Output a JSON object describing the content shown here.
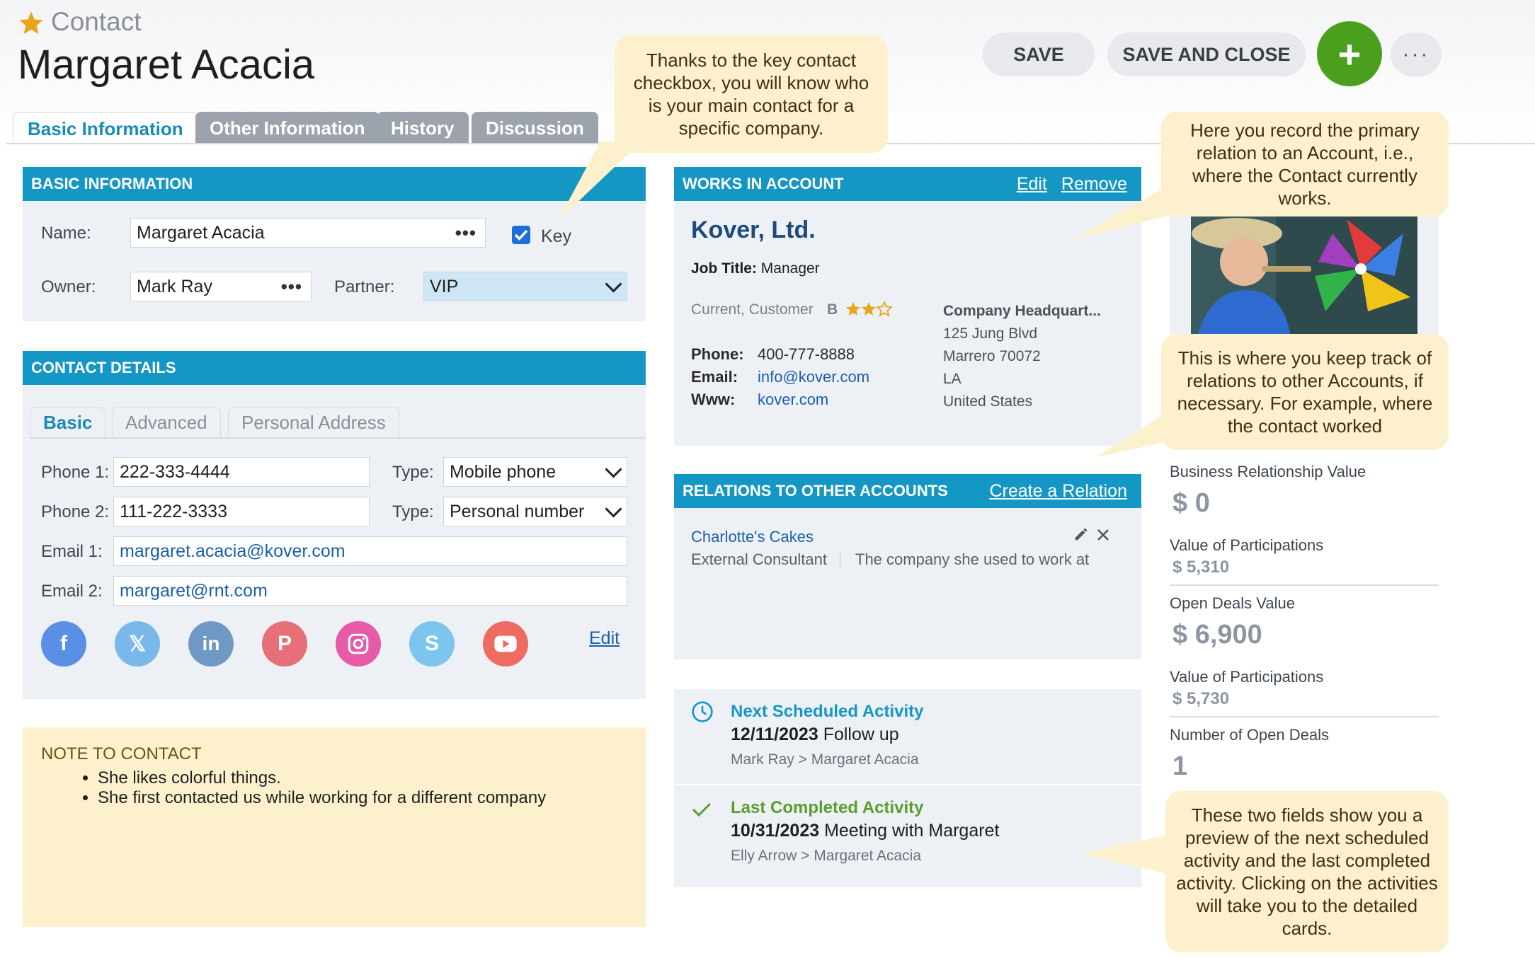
{
  "header": {
    "crumb": "Contact",
    "title": "Margaret Acacia",
    "save": "SAVE",
    "save_close": "SAVE AND CLOSE",
    "add": "+",
    "more": "···"
  },
  "tabs": [
    "Basic Information",
    "Other Information",
    "History",
    "Discussion"
  ],
  "basic": {
    "heading": "BASIC INFORMATION",
    "name_label": "Name:",
    "name_value": "Margaret Acacia",
    "key_label": "Key",
    "owner_label": "Owner:",
    "owner_value": "Mark Ray",
    "partner_label": "Partner:",
    "partner_value": "VIP"
  },
  "contact": {
    "heading": "CONTACT DETAILS",
    "subtabs": [
      "Basic",
      "Advanced",
      "Personal Address"
    ],
    "phone1_label": "Phone 1:",
    "phone1_value": "222-333-4444",
    "type1_label": "Type:",
    "type1_value": "Mobile phone",
    "phone2_label": "Phone 2:",
    "phone2_value": "111-222-3333",
    "type2_label": "Type:",
    "type2_value": "Personal number",
    "email1_label": "Email 1:",
    "email1_value": "margaret.acacia@kover.com",
    "email2_label": "Email 2:",
    "email2_value": "margaret@rnt.com",
    "social_edit": "Edit"
  },
  "note": {
    "heading": "NOTE TO CONTACT",
    "items": [
      "She likes colorful things.",
      "She first contacted us while working for a different company"
    ]
  },
  "works": {
    "heading": "WORKS IN ACCOUNT",
    "edit": "Edit",
    "remove": "Remove",
    "company": "Kover, Ltd.",
    "job_title_label": "Job Title:",
    "job_title_value": "Manager",
    "status": "Current, Customer",
    "grade": "B",
    "rating": 2,
    "rating_max": 3,
    "phone_label": "Phone:",
    "phone_value": "400-777-8888",
    "email_label": "Email:",
    "email_value": "info@kover.com",
    "www_label": "Www:",
    "www_value": "kover.com",
    "hq_label": "Company Headquart...",
    "address": [
      "125 Jung Blvd",
      "Marrero 70072",
      "LA",
      "United States"
    ]
  },
  "relations": {
    "heading": "RELATIONS TO OTHER ACCOUNTS",
    "create": "Create a Relation",
    "company": "Charlotte's Cakes",
    "role": "External Consultant",
    "note": "The company she used to work at"
  },
  "activity": {
    "next_label": "Next Scheduled Activity",
    "next_date": "12/11/2023",
    "next_title": "Follow up",
    "next_people": "Mark Ray > Margaret Acacia",
    "last_label": "Last Completed Activity",
    "last_date": "10/31/2023",
    "last_title": "Meeting with Margaret",
    "last_people": "Elly Arrow > Margaret Acacia"
  },
  "stats": {
    "brv_label": "Business Relationship Value",
    "brv_value": "$ 0",
    "vp1_label": "Value of Participations",
    "vp1_value": "$ 5,310",
    "odv_label": "Open Deals Value",
    "odv_value": "$ 6,900",
    "vp2_label": "Value of Participations",
    "vp2_value": "$ 5,730",
    "nod_label": "Number of Open Deals",
    "nod_value": "1"
  },
  "callouts": {
    "key": "Thanks to the key contact checkbox, you will know who is your main contact for a specific company.",
    "primary": "Here you record the primary relation to an Account, i.e., where the Contact currently works.",
    "relations": "This is where you keep track of relations to other Accounts, if necessary. For example, where the contact worked",
    "activities": "These two fields show you a preview of the next scheduled activity and the last completed activity. Clicking on the activities will take you to the detailed cards."
  },
  "colors": {
    "accent": "#1597c5",
    "add_button": "#4aa01c",
    "note_bg": "#fcf1cc",
    "star": "#e8a51a"
  }
}
